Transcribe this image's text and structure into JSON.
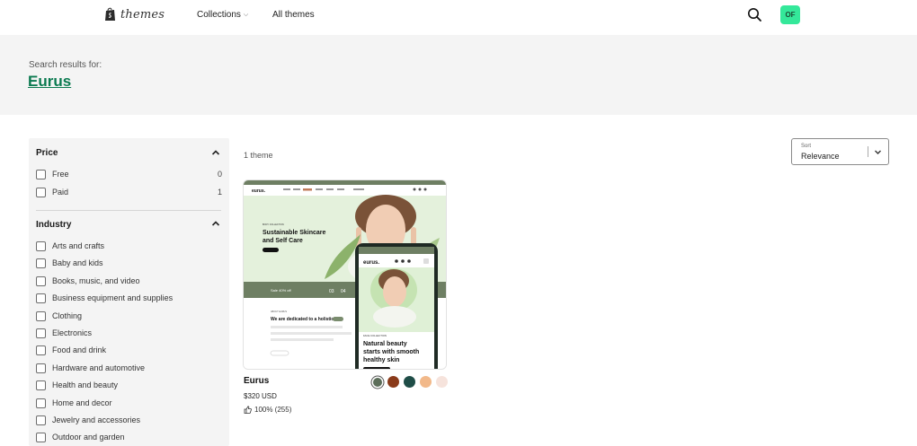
{
  "header": {
    "logo_text": "themes",
    "nav": {
      "collections": "Collections",
      "all_themes": "All themes"
    },
    "avatar_initials": "OF",
    "avatar_color": "#34e89a"
  },
  "search": {
    "label": "Search results for:",
    "query": "Eurus"
  },
  "filters": {
    "price": {
      "title": "Price",
      "options": [
        {
          "label": "Free",
          "count": "0"
        },
        {
          "label": "Paid",
          "count": "1"
        }
      ]
    },
    "industry": {
      "title": "Industry",
      "options": [
        "Arts and crafts",
        "Baby and kids",
        "Books, music, and video",
        "Business equipment and supplies",
        "Clothing",
        "Electronics",
        "Food and drink",
        "Hardware and automotive",
        "Health and beauty",
        "Home and decor",
        "Jewelry and accessories",
        "Outdoor and garden"
      ]
    }
  },
  "results": {
    "count_text": "1 theme",
    "sort": {
      "label": "Sort",
      "value": "Relevance"
    }
  },
  "theme_card": {
    "name": "Eurus",
    "price": "$320 USD",
    "rating": "100% (255)",
    "preview": {
      "brand": "eurus.",
      "hero_heading": "Sustainable Skincare and Self Care",
      "mobile_label": "FACE COLLECTION",
      "mobile_heading": "Natural beauty starts with smooth healthy skin",
      "promo_text": "Sale 40% off",
      "countdown": [
        "03",
        "04"
      ],
      "dedicated_text": "We are dedicated to a holistic"
    },
    "swatches": [
      "#5c6e5a",
      "#8a3a1a",
      "#1f4d47",
      "#f2b98a",
      "#f6e3dc"
    ]
  },
  "colors": {
    "accent": "#0b7a50",
    "sage": "#6e7f63",
    "mint_bg": "#e4f1dc"
  }
}
